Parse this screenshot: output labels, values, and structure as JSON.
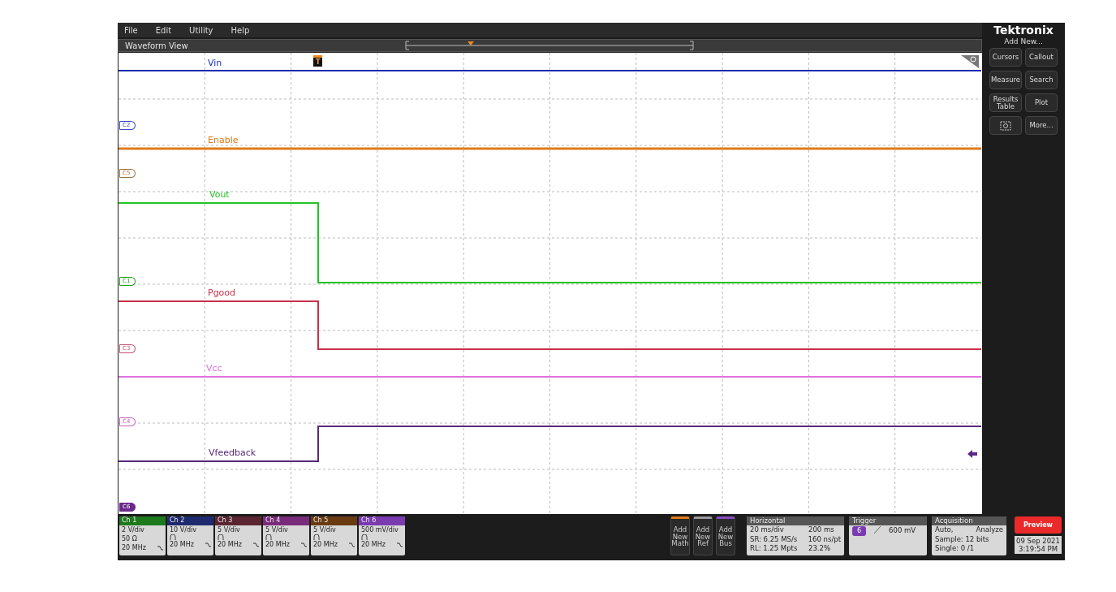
{
  "menu": [
    "File",
    "Edit",
    "Utility",
    "Help"
  ],
  "brand": "Tektronix",
  "view_title": "Waveform View",
  "trigger_marker": "T",
  "traces": [
    {
      "label": "Vin",
      "color": "#1a2db0"
    },
    {
      "label": "Enable",
      "color": "#e07b1a"
    },
    {
      "label": "Vout",
      "color": "#22c322"
    },
    {
      "label": "Pgood",
      "color": "#c8304a"
    },
    {
      "label": "Vcc",
      "color": "#e070e0"
    },
    {
      "label": "Vfeedback",
      "color": "#5a2a7a"
    }
  ],
  "channel_markers": [
    {
      "label": "C2",
      "color": "#3a4ac0"
    },
    {
      "label": "C5",
      "color": "#a0703a"
    },
    {
      "label": "C1",
      "color": "#22a022"
    },
    {
      "label": "C3",
      "color": "#c05070"
    },
    {
      "label": "C4",
      "color": "#c060c0"
    },
    {
      "label": "C6",
      "color": "#6a2a8a"
    }
  ],
  "add_panel": {
    "title": "Add New...",
    "buttons": [
      {
        "kind": "text",
        "label": "Cursors"
      },
      {
        "kind": "text",
        "label": "Callout"
      },
      {
        "kind": "text",
        "label": "Measure"
      },
      {
        "kind": "text",
        "label": "Search"
      },
      {
        "kind": "text",
        "label": "Results Table"
      },
      {
        "kind": "text",
        "label": "Plot"
      },
      {
        "kind": "icon"
      },
      {
        "kind": "text",
        "label": "More..."
      }
    ]
  },
  "channels": [
    {
      "label": "Ch 1",
      "color": "#1c7a1c",
      "scale": "2 V/div",
      "impedance": "50 Ω",
      "bandwidth": "20 MHz"
    },
    {
      "label": "Ch 2",
      "color": "#1e2a6e",
      "scale": "10 V/div",
      "bandwidth": "20 MHz"
    },
    {
      "label": "Ch 3",
      "color": "#5a2530",
      "scale": "5 V/div",
      "bandwidth": "20 MHz"
    },
    {
      "label": "Ch 4",
      "color": "#7a2a7a",
      "scale": "5 V/div",
      "bandwidth": "20 MHz"
    },
    {
      "label": "Ch 5",
      "color": "#6a3a10",
      "scale": "5 V/div",
      "bandwidth": "20 MHz"
    },
    {
      "label": "Ch 6",
      "color": "#7a3ab0",
      "scale": "500 mV/div",
      "bandwidth": "20 MHz"
    }
  ],
  "add_new": [
    {
      "label": "Add New Math",
      "color": "#e07b1a"
    },
    {
      "label": "Add New Ref",
      "color": "#9a9a9a"
    },
    {
      "label": "Add New Bus",
      "color": "#8a4ac0"
    }
  ],
  "horizontal": {
    "title": "Horizontal",
    "rows": [
      [
        "20 ms/div",
        "200 ms"
      ],
      [
        "SR: 6.25 MS/s",
        "160 ns/pt"
      ],
      [
        "RL: 1.25 Mpts",
        "23.2%"
      ]
    ]
  },
  "trigger": {
    "title": "Trigger",
    "source": "6",
    "level": "600 mV"
  },
  "acquisition": {
    "title": "Acquisition",
    "mode": "Auto,",
    "analyze": "Analyze",
    "sample": "Sample: 12 bits",
    "single": "Single: 0 /1"
  },
  "preview": "Preview",
  "date": "09 Sep 2021",
  "time": "3:19:54 PM"
}
